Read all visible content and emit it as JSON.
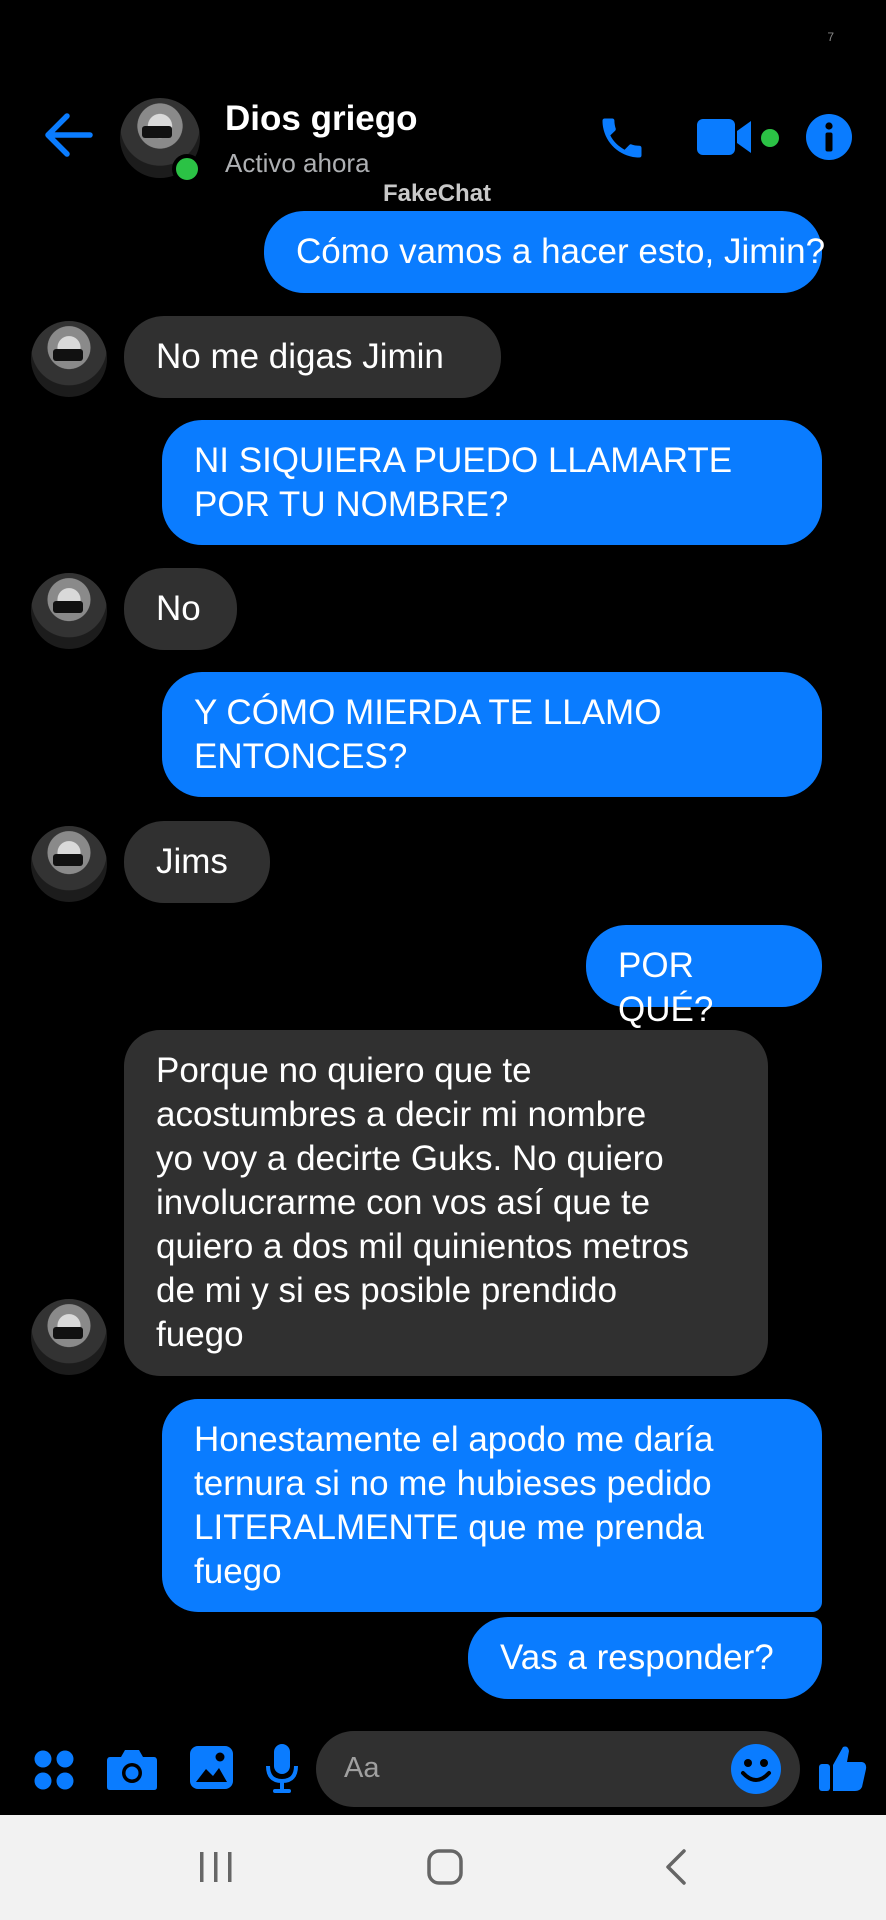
{
  "status": {
    "mark": "7"
  },
  "header": {
    "title": "Dios griego",
    "subtitle": "Activo ahora",
    "watermark": "FakeChat"
  },
  "colors": {
    "accent": "#0a7cff",
    "incoming_bubble": "#303030",
    "online": "#2bc245",
    "background": "#000000"
  },
  "messages": [
    {
      "direction": "out",
      "text": "Cómo vamos a hacer esto, Jimin?"
    },
    {
      "direction": "in",
      "text": "No me digas Jimin"
    },
    {
      "direction": "out",
      "text": "NI SIQUIERA PUEDO LLAMARTE\nPOR TU NOMBRE?"
    },
    {
      "direction": "in",
      "text": "No"
    },
    {
      "direction": "out",
      "text": "Y CÓMO MIERDA TE LLAMO\nENTONCES?"
    },
    {
      "direction": "in",
      "text": "Jims"
    },
    {
      "direction": "out",
      "text": "POR QUÉ?"
    },
    {
      "direction": "in",
      "text": "Porque no quiero que te\nacostumbres a decir mi nombre\nyo voy a decirte Guks. No quiero\ninvolucrarme con vos así que te\nquiero a dos mil quinientos metros\nde mi y si es posible prendido\nfuego"
    },
    {
      "direction": "out",
      "text": "Honestamente el apodo me daría\nternura si no me hubieses pedido\nLITERALMENTE que me prenda\nfuego"
    },
    {
      "direction": "out",
      "text": "Vas a responder?"
    }
  ],
  "composer": {
    "placeholder": "Aa",
    "icons": [
      "apps-icon",
      "camera-icon",
      "gallery-icon",
      "microphone-icon",
      "emoji-icon",
      "thumbs-up-icon"
    ]
  },
  "navbar": {
    "icons": [
      "recents-icon",
      "home-icon",
      "back-icon"
    ]
  }
}
